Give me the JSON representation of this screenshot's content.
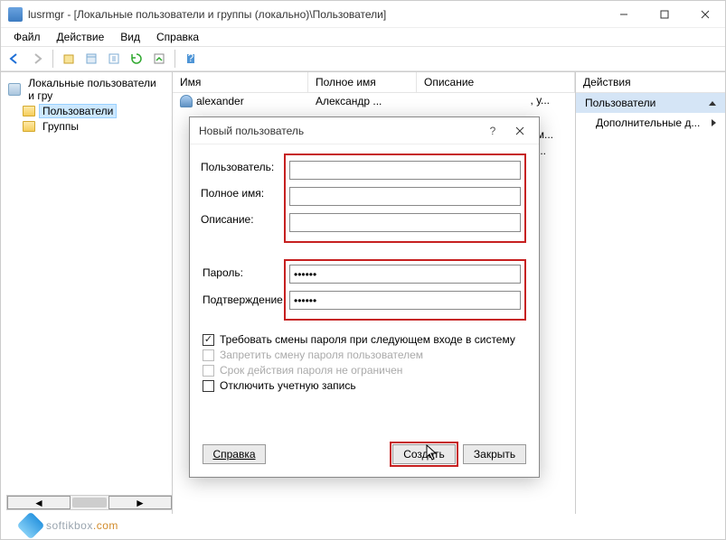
{
  "window": {
    "title": "lusrmgr - [Локальные пользователи и группы (локально)\\Пользователи]"
  },
  "menu": {
    "file": "Файл",
    "action": "Действие",
    "view": "Вид",
    "help": "Справка"
  },
  "tree": {
    "root": "Локальные пользователи и гру",
    "users": "Пользователи",
    "groups": "Группы"
  },
  "list": {
    "col_name": "Имя",
    "col_fullname": "Полное имя",
    "col_desc": "Описание",
    "rows": [
      {
        "name": "alexander",
        "full": "Александр ...",
        "desc": ""
      }
    ],
    "partial1": ", у...",
    "partial2": "дм...",
    "partial3": "а ..."
  },
  "actions": {
    "header": "Действия",
    "section": "Пользователи",
    "more": "Дополнительные д..."
  },
  "dialog": {
    "title": "Новый пользователь",
    "user": "Пользователь:",
    "fullname": "Полное имя:",
    "desc": "Описание:",
    "password": "Пароль:",
    "confirm": "Подтверждение:",
    "pw_value": "••••••",
    "chk_mustchange": "Требовать смены пароля при следующем входе в систему",
    "chk_cantchange": "Запретить смену пароля пользователем",
    "chk_neverexpire": "Срок действия пароля не ограничен",
    "chk_disabled": "Отключить учетную запись",
    "btn_help": "Справка",
    "btn_create": "Создать",
    "btn_close": "Закрыть"
  },
  "watermark": {
    "text1": "softikbox",
    "text2": ".com"
  }
}
